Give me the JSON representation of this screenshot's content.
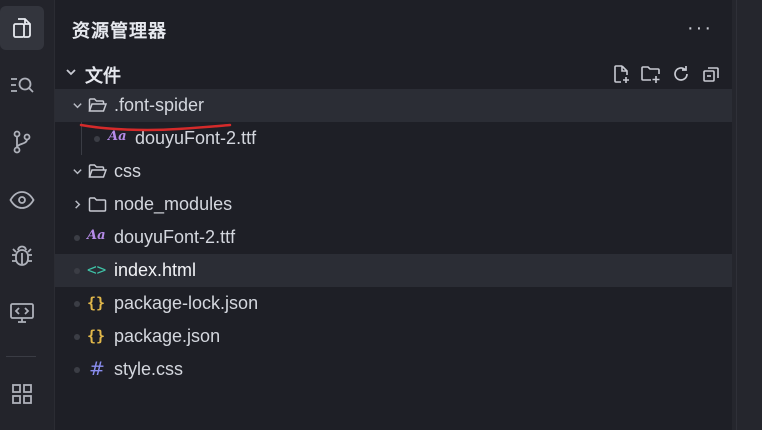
{
  "explorer": {
    "title": "资源管理器",
    "more_label": "···",
    "section_title": "文件"
  },
  "activity_bar": {
    "items": [
      {
        "icon": "files-icon",
        "active": true
      },
      {
        "icon": "search-icon",
        "active": false
      },
      {
        "icon": "source-control-icon",
        "active": false
      },
      {
        "icon": "preview-icon",
        "active": false
      },
      {
        "icon": "debug-icon",
        "active": false
      },
      {
        "icon": "remote-explorer-icon",
        "active": false
      },
      {
        "icon": "extensions-icon",
        "active": false
      }
    ]
  },
  "section_actions": [
    {
      "icon": "new-file-icon"
    },
    {
      "icon": "new-folder-icon"
    },
    {
      "icon": "refresh-icon"
    },
    {
      "icon": "collapse-all-icon"
    }
  ],
  "tree": {
    "font_spider": ".font-spider",
    "douyu_font_nested": "douyuFont-2.ttf",
    "css": "css",
    "node_modules": "node_modules",
    "douyu_font": "douyuFont-2.ttf",
    "index_html": "index.html",
    "package_lock": "package-lock.json",
    "package_json": "package.json",
    "style_css": "style.css"
  },
  "file_icons": {
    "font": "Aa",
    "html": "<>",
    "json": "{}",
    "css": "#"
  },
  "colors": {
    "background": "#1e1f26",
    "activity_bar": "#23242b",
    "highlight_row": "#2b2d35",
    "annotation": "#d42a2a",
    "font_icon": "#b58be8",
    "html_icon": "#3fc4a8",
    "json_icon": "#e2b84a",
    "css_icon": "#8a8ef0"
  }
}
